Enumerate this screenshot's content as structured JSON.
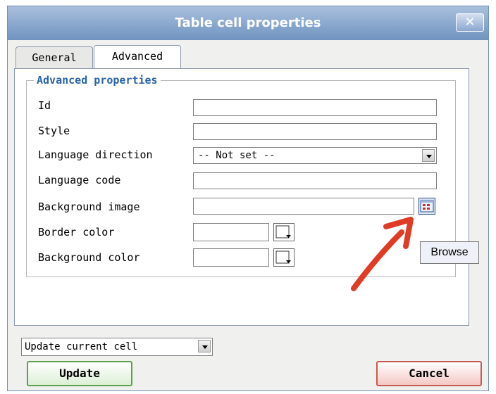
{
  "dialog": {
    "title": "Table cell properties",
    "close_label": "✕"
  },
  "tabs": [
    {
      "label": "General"
    },
    {
      "label": "Advanced"
    }
  ],
  "advanced": {
    "legend": "Advanced properties",
    "id_label": "Id",
    "style_label": "Style",
    "lang_dir_label": "Language direction",
    "lang_dir_value": "-- Not set --",
    "lang_code_label": "Language code",
    "bg_image_label": "Background image",
    "border_color_label": "Border color",
    "bg_color_label": "Background color"
  },
  "tooltip": {
    "text": "Browse"
  },
  "footer": {
    "update_mode": "Update current cell",
    "update_label": "Update",
    "cancel_label": "Cancel"
  },
  "annotation": {
    "arrow_color": "#e03b24"
  },
  "icons": {
    "browse": "browse-icon",
    "color_picker": "color-picker-icon"
  }
}
